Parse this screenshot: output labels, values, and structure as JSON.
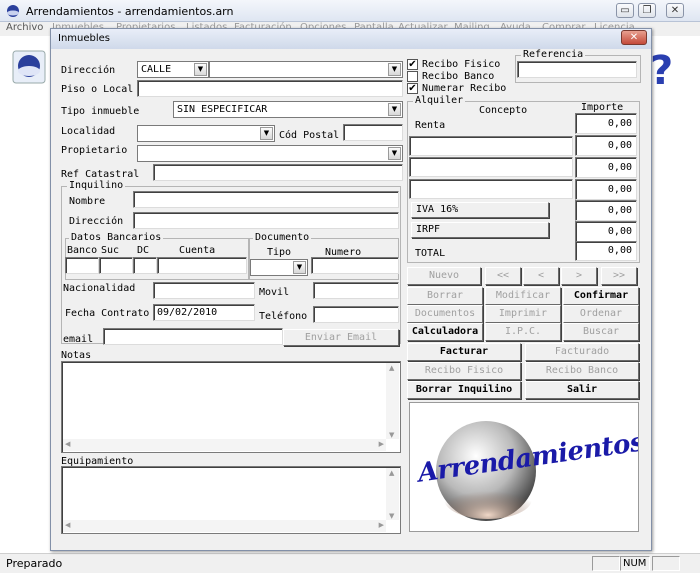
{
  "app": {
    "title": "Arrendamientos - arrendamientos.arn",
    "menu": [
      "Archivo",
      "Inmuebles",
      "Propietarios",
      "Listados",
      "Facturación",
      "Opciones",
      "Pantalla",
      "Actualizar",
      "Mailing",
      "Ayuda",
      "Comprar",
      "Licencia"
    ],
    "status": "Preparado",
    "status_num": "NUM",
    "win_minimize": "▭",
    "win_restore": "❐",
    "win_close": "✕"
  },
  "dialog": {
    "title": "Inmuebles",
    "close": "✕",
    "direccion_label": "Dirección",
    "direccion_tipo": "CALLE",
    "direccion_value": "",
    "piso_label": "Piso o Local",
    "tipo_inmueble_label": "Tipo inmueble",
    "tipo_inmueble_value": "SIN ESPECIFICAR",
    "localidad_label": "Localidad",
    "cod_postal_label": "Cód Postal",
    "propietario_label": "Propietario",
    "ref_catastral_label": "Ref Catastral",
    "inquilino_group": "Inquilino",
    "nombre_label": "Nombre",
    "inq_direccion_label": "Dirección",
    "datos_bancarios_group": "Datos Bancarios",
    "banco_label": "Banco",
    "suc_label": "Suc",
    "dc_label": "DC",
    "cuenta_label": "Cuenta",
    "documento_group": "Documento",
    "tipo_label": "Tipo",
    "numero_label": "Numero",
    "nacionalidad_label": "Nacionalidad",
    "movil_label": "Movil",
    "fecha_contrato_label": "Fecha Contrato",
    "fecha_contrato_value": "09/02/2010",
    "telefono_label": "Teléfono",
    "email_label": "email",
    "enviar_email": "Enviar Email",
    "notas_label": "Notas",
    "equipamiento_label": "Equipamiento",
    "recibo_fisico_label": "Recibo Fisico",
    "recibo_fisico_checked": true,
    "recibo_banco_label": "Recibo Banco",
    "recibo_banco_checked": false,
    "numerar_recibo_label": "Numerar Recibo",
    "numerar_recibo_checked": true,
    "referencia_label": "Referencia",
    "alquiler_group": "Alquiler",
    "concepto_label": "Concepto",
    "importe_label": "Importe",
    "rows": [
      {
        "concepto": "Renta",
        "importe": "0,00"
      },
      {
        "concepto": "",
        "importe": "0,00"
      },
      {
        "concepto": "",
        "importe": "0,00"
      },
      {
        "concepto": "",
        "importe": "0,00"
      }
    ],
    "iva_label": "IVA 16%",
    "iva_value": "0,00",
    "irpf_label": "IRPF",
    "irpf_value": "0,00",
    "total_label": "TOTAL",
    "total_value": "0,00",
    "btn_nuevo": "Nuevo",
    "btn_first": "<<",
    "btn_prev": "<",
    "btn_next": ">",
    "btn_last": ">>",
    "btn_borrar": "Borrar",
    "btn_modificar": "Modificar",
    "btn_confirmar": "Confirmar",
    "btn_documentos": "Documentos",
    "btn_imprimir": "Imprimir",
    "btn_ordenar": "Ordenar",
    "btn_calculadora": "Calculadora",
    "btn_ipc": "I.P.C.",
    "btn_buscar": "Buscar",
    "btn_facturar": "Facturar",
    "btn_facturado": "Facturado",
    "btn_recibo_fisico": "Recibo Fisico",
    "btn_recibo_banco": "Recibo Banco",
    "btn_borrar_inquilino": "Borrar Inquilino",
    "btn_salir": "Salir",
    "logo_text": "Arrendamientos.es"
  },
  "colors": {
    "logo_blue": "#1a1aa8",
    "dialog_bg": "#f0f0f0",
    "title_text": "#000000"
  }
}
